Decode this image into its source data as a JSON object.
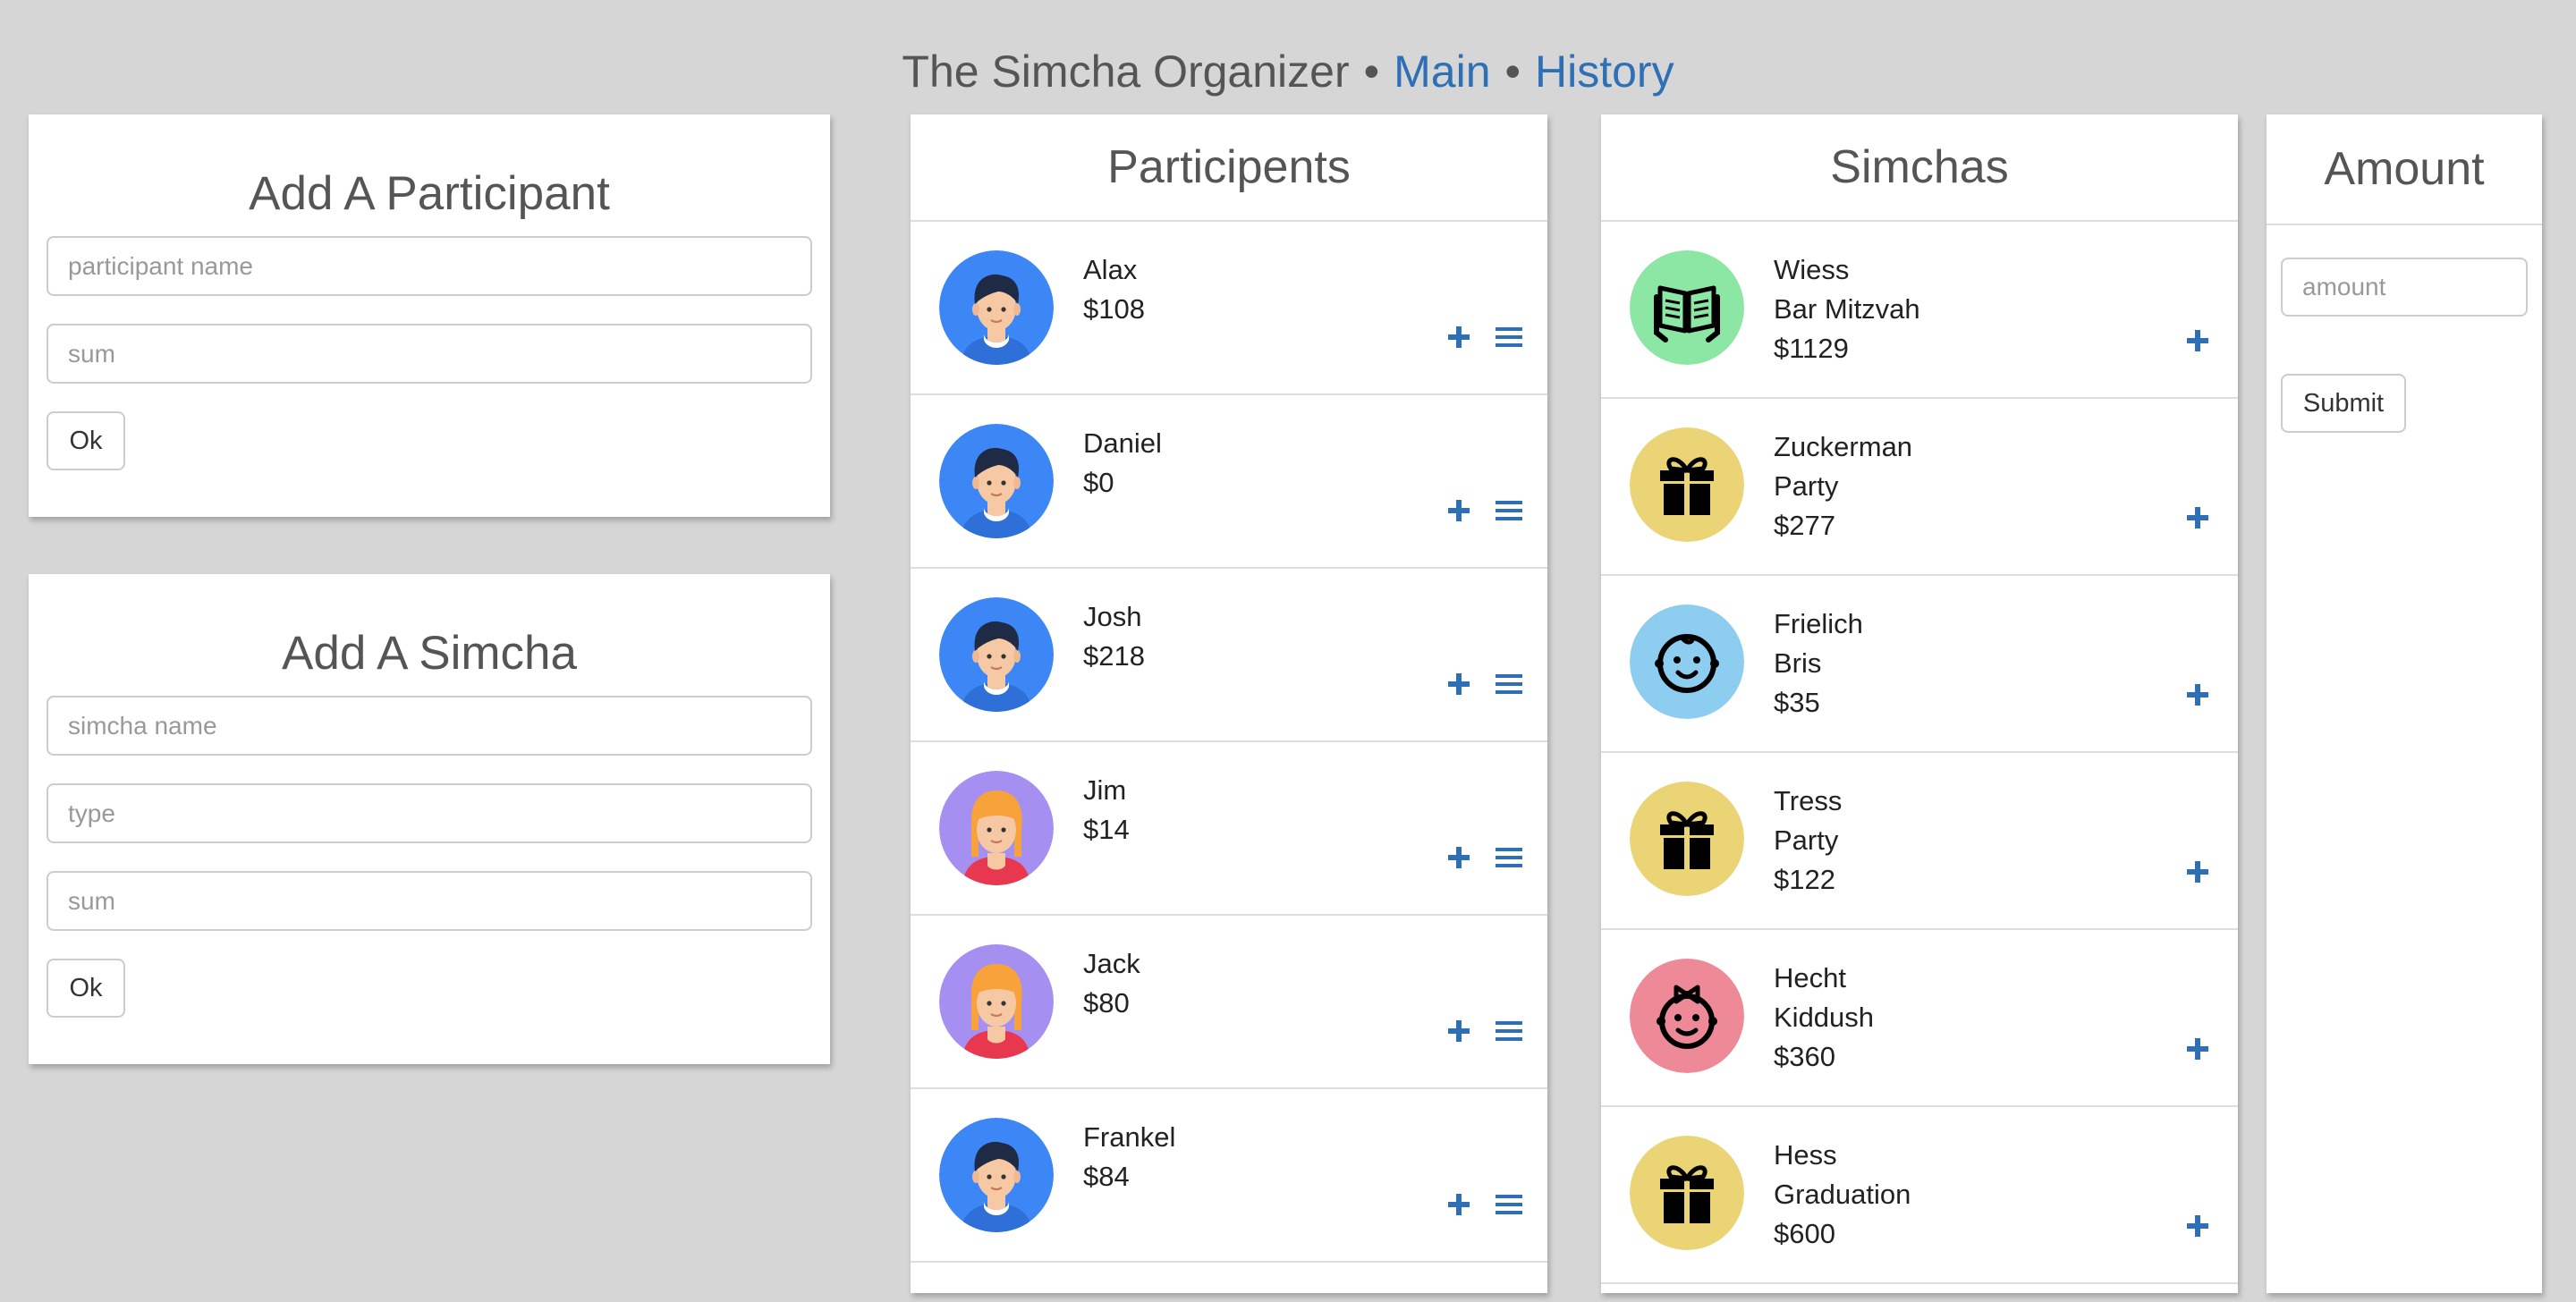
{
  "header": {
    "title": "The Simcha Organizer",
    "separator": "•",
    "links": [
      "Main",
      "History"
    ]
  },
  "add_participant": {
    "title": "Add A Participant",
    "name_placeholder": "participant name",
    "sum_placeholder": "sum",
    "ok_label": "Ok"
  },
  "add_simcha": {
    "title": "Add A Simcha",
    "name_placeholder": "simcha name",
    "type_placeholder": "type",
    "sum_placeholder": "sum",
    "ok_label": "Ok"
  },
  "participants": {
    "title": "Participents",
    "items": [
      {
        "name": "Alax",
        "amount": "$108",
        "avatar": "boy-avatar-icon"
      },
      {
        "name": "Daniel",
        "amount": "$0",
        "avatar": "boy-avatar-icon"
      },
      {
        "name": "Josh",
        "amount": "$218",
        "avatar": "boy-avatar-icon"
      },
      {
        "name": "Jim",
        "amount": "$14",
        "avatar": "girl-avatar-icon"
      },
      {
        "name": "Jack",
        "amount": "$80",
        "avatar": "girl-avatar-icon"
      },
      {
        "name": "Frankel",
        "amount": "$84",
        "avatar": "boy-avatar-icon"
      }
    ]
  },
  "simchas": {
    "title": "Simchas",
    "items": [
      {
        "name": "Wiess",
        "type": "Bar Mitzvah",
        "amount": "$1129",
        "icon": "book-reader-icon"
      },
      {
        "name": "Zuckerman",
        "type": "Party",
        "amount": "$277",
        "icon": "gift-icon"
      },
      {
        "name": "Frielich",
        "type": "Bris",
        "amount": "$35",
        "icon": "baby-face-icon"
      },
      {
        "name": "Tress",
        "type": "Party",
        "amount": "$122",
        "icon": "gift-icon"
      },
      {
        "name": "Hecht",
        "type": "Kiddush",
        "amount": "$360",
        "icon": "baby-girl-face-icon"
      },
      {
        "name": "Hess",
        "type": "Graduation",
        "amount": "$600",
        "icon": "gift-icon"
      }
    ]
  },
  "amount_panel": {
    "title": "Amount",
    "placeholder": "amount",
    "submit_label": "Submit"
  },
  "colors": {
    "background": "#d6d6d6",
    "link": "#2e6fb5",
    "boy_avatar_bg": "#3d86f5",
    "girl_avatar_bg": "#a58ff0",
    "book_bg": "#8ce6a4",
    "gift_bg": "#ead475",
    "baby_bg": "#8ccdf0",
    "baby_girl_bg": "#ee8a98"
  }
}
